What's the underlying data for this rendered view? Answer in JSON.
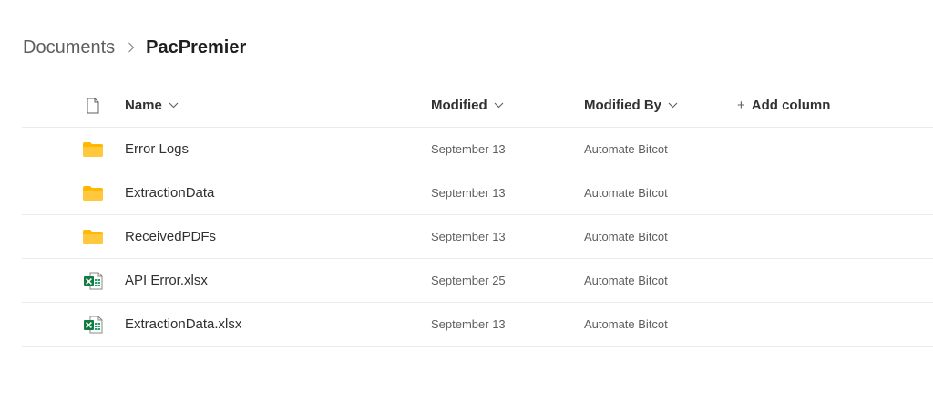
{
  "breadcrumb": {
    "parent": "Documents",
    "current": "PacPremier"
  },
  "columns": {
    "name": "Name",
    "modified": "Modified",
    "modified_by": "Modified By",
    "add_column": "Add column"
  },
  "rows": [
    {
      "type": "folder",
      "icon": "folder-icon",
      "name": "Error Logs",
      "modified": "September 13",
      "modified_by": "Automate Bitcot"
    },
    {
      "type": "folder",
      "icon": "folder-icon",
      "name": "ExtractionData",
      "modified": "September 13",
      "modified_by": "Automate Bitcot"
    },
    {
      "type": "folder",
      "icon": "folder-icon",
      "name": "ReceivedPDFs",
      "modified": "September 13",
      "modified_by": "Automate Bitcot"
    },
    {
      "type": "excel",
      "icon": "excel-file-icon",
      "name": "API Error.xlsx",
      "modified": "September 25",
      "modified_by": "Automate Bitcot"
    },
    {
      "type": "excel",
      "icon": "excel-file-icon",
      "name": "ExtractionData.xlsx",
      "modified": "September 13",
      "modified_by": "Automate Bitcot"
    }
  ],
  "colors": {
    "folder": "#FFC83D",
    "folder_tab": "#FFB900",
    "excel_green": "#107C41"
  }
}
